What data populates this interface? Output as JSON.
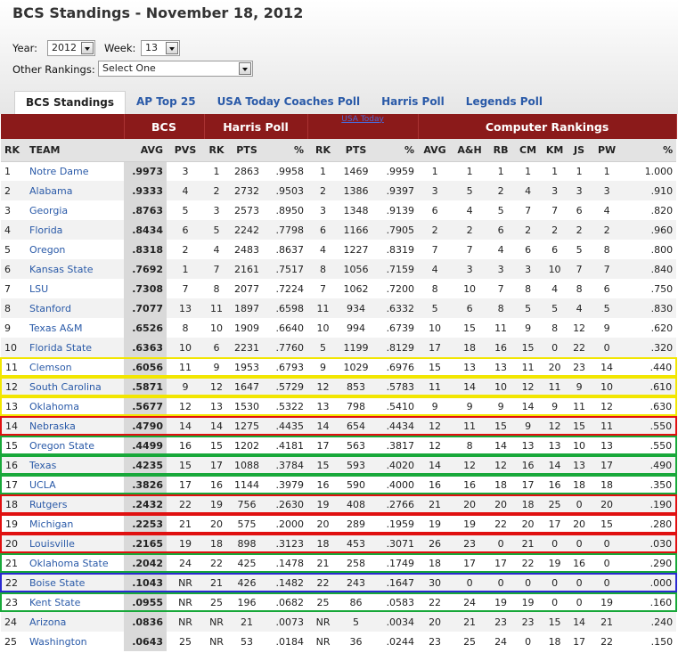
{
  "page": {
    "title": "BCS Standings - November 18, 2012",
    "year_label": "Year:",
    "year_value": "2012",
    "week_label": "Week:",
    "week_value": "13",
    "other_label": "Other Rankings:",
    "other_value": "Select One"
  },
  "tabs": [
    "BCS Standings",
    "AP Top 25",
    "USA Today Coaches Poll",
    "Harris Poll",
    "Legends Poll"
  ],
  "table": {
    "groups": {
      "bcs": "BCS",
      "harris": "Harris Poll",
      "usa": "USA Today",
      "computer": "Computer Rankings"
    },
    "columns": [
      "RK",
      "TEAM",
      "AVG",
      "PVS",
      "RK",
      "PTS",
      "%",
      "RK",
      "PTS",
      "%",
      "AVG",
      "A&H",
      "RB",
      "CM",
      "KM",
      "JS",
      "PW",
      "%"
    ],
    "rows": [
      [
        "1",
        "Notre Dame",
        ".9973",
        "3",
        "1",
        "2863",
        ".9958",
        "1",
        "1469",
        ".9959",
        "1",
        "1",
        "1",
        "1",
        "1",
        "1",
        "1",
        "1.000"
      ],
      [
        "2",
        "Alabama",
        ".9333",
        "4",
        "2",
        "2732",
        ".9503",
        "2",
        "1386",
        ".9397",
        "3",
        "5",
        "2",
        "4",
        "3",
        "3",
        "3",
        ".910"
      ],
      [
        "3",
        "Georgia",
        ".8763",
        "5",
        "3",
        "2573",
        ".8950",
        "3",
        "1348",
        ".9139",
        "6",
        "4",
        "5",
        "7",
        "7",
        "6",
        "4",
        ".820"
      ],
      [
        "4",
        "Florida",
        ".8434",
        "6",
        "5",
        "2242",
        ".7798",
        "6",
        "1166",
        ".7905",
        "2",
        "2",
        "6",
        "2",
        "2",
        "2",
        "2",
        ".960"
      ],
      [
        "5",
        "Oregon",
        ".8318",
        "2",
        "4",
        "2483",
        ".8637",
        "4",
        "1227",
        ".8319",
        "7",
        "7",
        "4",
        "6",
        "6",
        "5",
        "8",
        ".800"
      ],
      [
        "6",
        "Kansas State",
        ".7692",
        "1",
        "7",
        "2161",
        ".7517",
        "8",
        "1056",
        ".7159",
        "4",
        "3",
        "3",
        "3",
        "10",
        "7",
        "7",
        ".840"
      ],
      [
        "7",
        "LSU",
        ".7308",
        "7",
        "8",
        "2077",
        ".7224",
        "7",
        "1062",
        ".7200",
        "8",
        "10",
        "7",
        "8",
        "4",
        "8",
        "6",
        ".750"
      ],
      [
        "8",
        "Stanford",
        ".7077",
        "13",
        "11",
        "1897",
        ".6598",
        "11",
        "934",
        ".6332",
        "5",
        "6",
        "8",
        "5",
        "5",
        "4",
        "5",
        ".830"
      ],
      [
        "9",
        "Texas A&M",
        ".6526",
        "8",
        "10",
        "1909",
        ".6640",
        "10",
        "994",
        ".6739",
        "10",
        "15",
        "11",
        "9",
        "8",
        "12",
        "9",
        ".620"
      ],
      [
        "10",
        "Florida State",
        ".6363",
        "10",
        "6",
        "2231",
        ".7760",
        "5",
        "1199",
        ".8129",
        "17",
        "18",
        "16",
        "15",
        "0",
        "22",
        "0",
        ".320"
      ],
      [
        "11",
        "Clemson",
        ".6056",
        "11",
        "9",
        "1953",
        ".6793",
        "9",
        "1029",
        ".6976",
        "15",
        "13",
        "13",
        "11",
        "20",
        "23",
        "14",
        ".440"
      ],
      [
        "12",
        "South Carolina",
        ".5871",
        "9",
        "12",
        "1647",
        ".5729",
        "12",
        "853",
        ".5783",
        "11",
        "14",
        "10",
        "12",
        "11",
        "9",
        "10",
        ".610"
      ],
      [
        "13",
        "Oklahoma",
        ".5677",
        "12",
        "13",
        "1530",
        ".5322",
        "13",
        "798",
        ".5410",
        "9",
        "9",
        "9",
        "14",
        "9",
        "11",
        "12",
        ".630"
      ],
      [
        "14",
        "Nebraska",
        ".4790",
        "14",
        "14",
        "1275",
        ".4435",
        "14",
        "654",
        ".4434",
        "12",
        "11",
        "15",
        "9",
        "12",
        "15",
        "11",
        ".550"
      ],
      [
        "15",
        "Oregon State",
        ".4499",
        "16",
        "15",
        "1202",
        ".4181",
        "17",
        "563",
        ".3817",
        "12",
        "8",
        "14",
        "13",
        "13",
        "10",
        "13",
        ".550"
      ],
      [
        "16",
        "Texas",
        ".4235",
        "15",
        "17",
        "1088",
        ".3784",
        "15",
        "593",
        ".4020",
        "14",
        "12",
        "12",
        "16",
        "14",
        "13",
        "17",
        ".490"
      ],
      [
        "17",
        "UCLA",
        ".3826",
        "17",
        "16",
        "1144",
        ".3979",
        "16",
        "590",
        ".4000",
        "16",
        "16",
        "18",
        "17",
        "16",
        "18",
        "18",
        ".350"
      ],
      [
        "18",
        "Rutgers",
        ".2432",
        "22",
        "19",
        "756",
        ".2630",
        "19",
        "408",
        ".2766",
        "21",
        "20",
        "20",
        "18",
        "25",
        "0",
        "20",
        ".190"
      ],
      [
        "19",
        "Michigan",
        ".2253",
        "21",
        "20",
        "575",
        ".2000",
        "20",
        "289",
        ".1959",
        "19",
        "19",
        "22",
        "20",
        "17",
        "20",
        "15",
        ".280"
      ],
      [
        "20",
        "Louisville",
        ".2165",
        "19",
        "18",
        "898",
        ".3123",
        "18",
        "453",
        ".3071",
        "26",
        "23",
        "0",
        "21",
        "0",
        "0",
        "0",
        ".030"
      ],
      [
        "21",
        "Oklahoma State",
        ".2042",
        "24",
        "22",
        "425",
        ".1478",
        "21",
        "258",
        ".1749",
        "18",
        "17",
        "17",
        "22",
        "19",
        "16",
        "0",
        ".290"
      ],
      [
        "22",
        "Boise State",
        ".1043",
        "NR",
        "21",
        "426",
        ".1482",
        "22",
        "243",
        ".1647",
        "30",
        "0",
        "0",
        "0",
        "0",
        "0",
        "0",
        ".000"
      ],
      [
        "23",
        "Kent State",
        ".0955",
        "NR",
        "25",
        "196",
        ".0682",
        "25",
        "86",
        ".0583",
        "22",
        "24",
        "19",
        "19",
        "0",
        "0",
        "19",
        ".160"
      ],
      [
        "24",
        "Arizona",
        ".0836",
        "NR",
        "NR",
        "21",
        ".0073",
        "NR",
        "5",
        ".0034",
        "20",
        "21",
        "23",
        "23",
        "15",
        "14",
        "21",
        ".240"
      ],
      [
        "25",
        "Washington",
        ".0643",
        "25",
        "NR",
        "53",
        ".0184",
        "NR",
        "36",
        ".0244",
        "23",
        "25",
        "24",
        "0",
        "18",
        "17",
        "22",
        ".150"
      ]
    ],
    "highlights": {
      "yellow": [
        11,
        12,
        13
      ],
      "red": [
        14,
        18,
        19,
        20
      ],
      "green": [
        15,
        16,
        17,
        21,
        23
      ],
      "blue": [
        22
      ]
    },
    "highlight_colors": {
      "yellow": "#f2e600",
      "red": "#e01010",
      "green": "#18a83a",
      "blue": "#2a2ad0"
    }
  }
}
